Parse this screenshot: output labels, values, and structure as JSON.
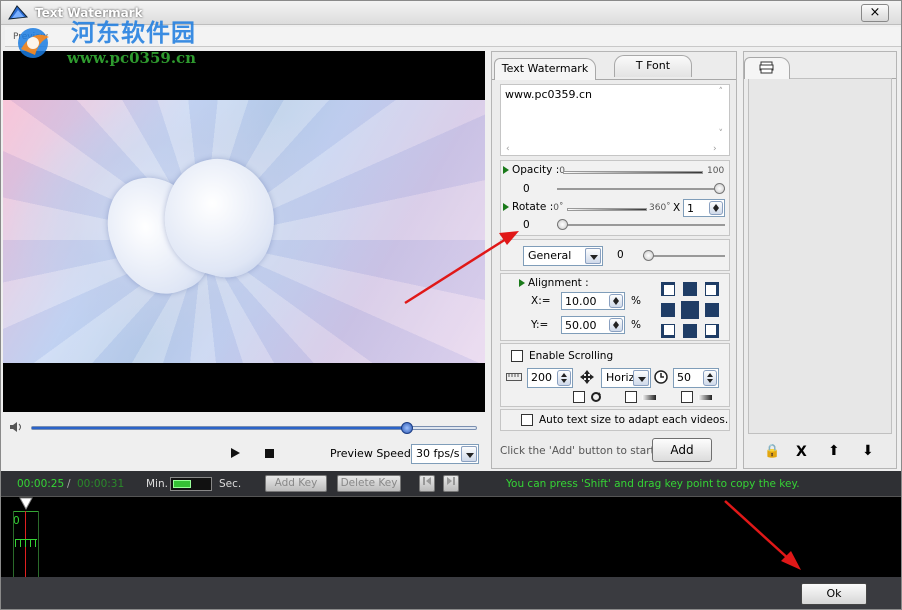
{
  "window": {
    "title": "Text Watermark",
    "close_label": "×"
  },
  "preview_tab": {
    "label": "Preview"
  },
  "site_watermark": {
    "line1": "河东软件园",
    "line2": "www.pc0359.cn"
  },
  "player": {
    "seek_progress": 0.84,
    "speed_label": "Preview Speed:",
    "speed_value": "30 fps/s"
  },
  "text_panel": {
    "tab_text": "Text Watermark",
    "tab_font": "T Font",
    "text_value": "www.pc0359.cn",
    "opacity": {
      "label": "Opacity",
      "min": "0",
      "max": "100",
      "value": "0",
      "level": 1.0
    },
    "rotate": {
      "label": "Rotate",
      "min": "0˚",
      "max": "360˚",
      "multiplier_sign": "X",
      "multiplier": "1",
      "value": "0",
      "level": 0.0
    },
    "effect": {
      "selected": "General",
      "value": "0",
      "level": 0.0
    },
    "alignment": {
      "label": "Alignment :",
      "x_label": "X:=",
      "x_value": "10.00",
      "x_unit": "%",
      "y_label": "Y:=",
      "y_value": "50.00",
      "y_unit": "%"
    },
    "scrolling": {
      "label": "Enable Scrolling",
      "distance": "200",
      "direction": "Horiz",
      "speed": "50"
    },
    "auto_size_label": "Auto text size to adapt each videos.",
    "add_hint": "Click the 'Add' button to start ->",
    "add_button": "Add"
  },
  "right_panel": {
    "lock_label": "🔒",
    "delete_label": "X",
    "up_label": "⬆",
    "down_label": "⬇"
  },
  "timeline": {
    "current_time": "00:00:25",
    "separator": "/",
    "total_time": "00:00:31",
    "min_label": "Min.",
    "sec_label": "Sec.",
    "add_key": "Add Key",
    "delete_key": "Delete Key",
    "hint": "You can press 'Shift' and drag key point to copy the key.",
    "marker_label": "0"
  },
  "footer": {
    "ok_label": "Ok"
  },
  "colors": {
    "accent_blue": "#2a63c9",
    "timeline_green": "#35d435",
    "arrow_red": "#e01818"
  }
}
